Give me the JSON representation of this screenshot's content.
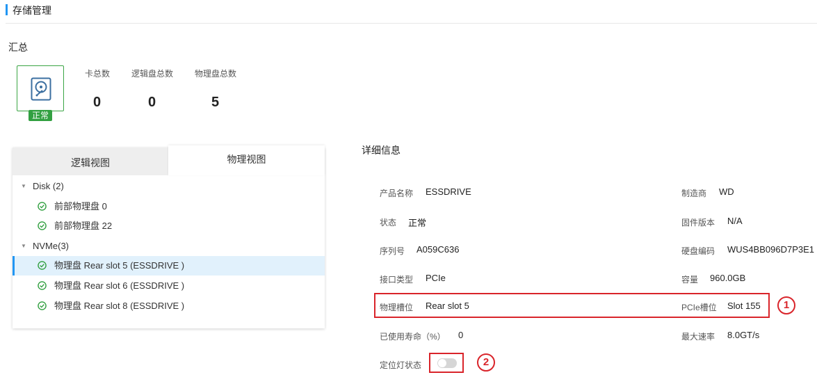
{
  "header": {
    "title": "存储管理"
  },
  "summary": {
    "label": "汇总",
    "status_badge": "正常",
    "stats": [
      {
        "label": "卡总数",
        "value": "0"
      },
      {
        "label": "逻辑盘总数",
        "value": "0"
      },
      {
        "label": "物理盘总数",
        "value": "5"
      }
    ]
  },
  "view_tabs": {
    "logical": "逻辑视图",
    "physical": "物理视图"
  },
  "tree": {
    "groups": [
      {
        "label": "Disk (2)",
        "items": [
          "前部物理盘 0",
          "前部物理盘 22"
        ]
      },
      {
        "label": "NVMe(3)",
        "items": [
          "物理盘 Rear slot 5 (ESSDRIVE )",
          "物理盘 Rear slot 6 (ESSDRIVE )",
          "物理盘 Rear slot 8 (ESSDRIVE )"
        ]
      }
    ]
  },
  "details": {
    "title": "详细信息",
    "product_name": {
      "label": "产品名称",
      "value": "ESSDRIVE"
    },
    "manufacturer": {
      "label": "制造商",
      "value": "WD"
    },
    "status": {
      "label": "状态",
      "value": "正常"
    },
    "firmware": {
      "label": "固件版本",
      "value": "N/A"
    },
    "serial": {
      "label": "序列号",
      "value": "A059C636"
    },
    "disk_code": {
      "label": "硬盘编码",
      "value": "WUS4BB096D7P3E1"
    },
    "interface": {
      "label": "接口类型",
      "value": "PCIe"
    },
    "capacity": {
      "label": "容量",
      "value": "960.0GB"
    },
    "physical_slot": {
      "label": "物理槽位",
      "value": "Rear slot 5"
    },
    "pcie_slot": {
      "label": "PCIe槽位",
      "value": "Slot 155"
    },
    "life_used": {
      "label": "已使用寿命（%）",
      "value": "0"
    },
    "max_rate": {
      "label": "最大速率",
      "value": "8.0GT/s"
    },
    "locate_led": {
      "label": "定位灯状态"
    }
  },
  "annotations": {
    "one": "1",
    "two": "2"
  },
  "colors": {
    "accent": "#2196f3",
    "ok": "#32a041",
    "highlight": "#d9242a"
  },
  "icons": {
    "disk": "hard-disk-icon",
    "check": "check-circle-icon",
    "caret": "caret-down-icon"
  }
}
